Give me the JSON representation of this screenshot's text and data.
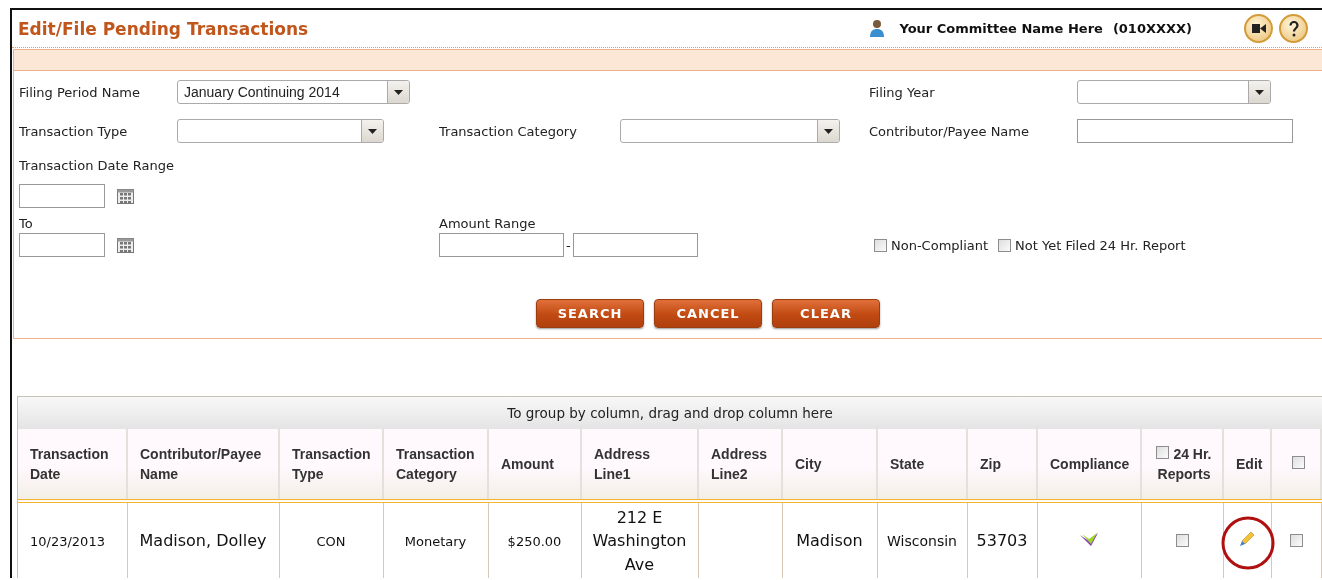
{
  "header": {
    "title": "Edit/File Pending Transactions",
    "committee_name": "Your Committee Name Here",
    "committee_id": "(010XXXX)"
  },
  "filters": {
    "filing_period_name": {
      "label": "Filing Period Name",
      "value": "January Continuing 2014"
    },
    "filing_year": {
      "label": "Filing Year"
    },
    "transaction_type": {
      "label": "Transaction Type"
    },
    "transaction_category": {
      "label": "Transaction Category"
    },
    "contributor_payee_name": {
      "label": "Contributor/Payee Name"
    },
    "date_range": {
      "label": "Transaction Date Range",
      "to_label": "To"
    },
    "amount_range": {
      "label": "Amount Range",
      "separator": "-"
    },
    "options": [
      {
        "label": "Non-Compliant",
        "checked": false
      },
      {
        "label": "Not Yet Filed 24 Hr. Report",
        "checked": false
      }
    ]
  },
  "buttons": [
    "SEARCH",
    "CANCEL",
    "CLEAR"
  ],
  "grid": {
    "group_hint": "To group by column, drag and drop column here",
    "columns": [
      {
        "kind": "text",
        "label": "Transaction Date"
      },
      {
        "kind": "text",
        "label": "Contributor/Payee Name"
      },
      {
        "kind": "text",
        "label": "Transaction Type"
      },
      {
        "kind": "text",
        "label": "Transaction Category"
      },
      {
        "kind": "text",
        "label": "Amount"
      },
      {
        "kind": "text",
        "label": "Address Line1"
      },
      {
        "kind": "text",
        "label": "Address Line2"
      },
      {
        "kind": "text",
        "label": "City"
      },
      {
        "kind": "text",
        "label": "State"
      },
      {
        "kind": "text",
        "label": "Zip"
      },
      {
        "kind": "text",
        "label": "Compliance"
      },
      {
        "kind": "checkbox",
        "label": "24 Hr. Reports",
        "checked": false
      },
      {
        "kind": "text",
        "label": "Edit"
      },
      {
        "kind": "checkbox",
        "checked": false
      }
    ],
    "rows": [
      {
        "cells": [
          {
            "kind": "text",
            "text": "10/23/2013"
          },
          {
            "kind": "text",
            "text": "Madison, Dolley"
          },
          {
            "kind": "text",
            "text": "CON"
          },
          {
            "kind": "text",
            "text": "Monetary"
          },
          {
            "kind": "text",
            "text": "$250.00"
          },
          {
            "kind": "text",
            "text": "212 E Washington Ave"
          },
          {
            "kind": "text",
            "text": ""
          },
          {
            "kind": "text",
            "text": "Madison"
          },
          {
            "kind": "text",
            "text": "Wisconsin"
          },
          {
            "kind": "text",
            "text": "53703"
          },
          {
            "kind": "compliance"
          },
          {
            "kind": "checkbox",
            "checked": false
          },
          {
            "kind": "edit",
            "highlighted": true
          },
          {
            "kind": "checkbox",
            "checked": false
          }
        ]
      }
    ]
  }
}
